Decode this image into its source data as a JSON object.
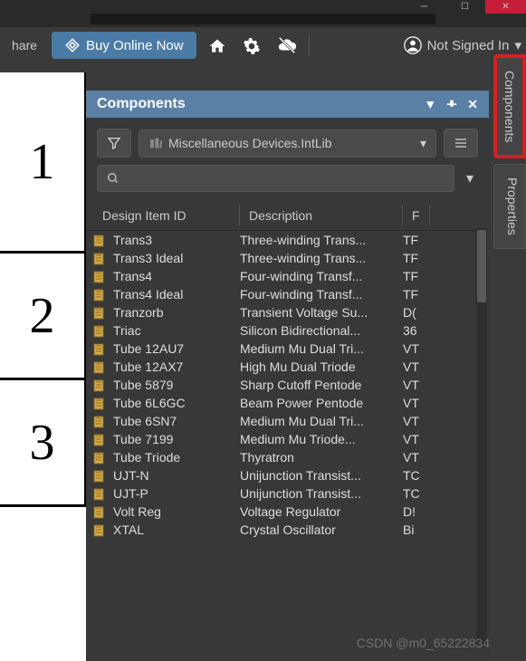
{
  "toolbar": {
    "share_label": "hare",
    "buy_label": "Buy Online Now",
    "signin_label": "Not Signed In"
  },
  "schematic": {
    "cells": [
      "1",
      "2",
      "3"
    ]
  },
  "panel": {
    "title": "Components",
    "library": "Miscellaneous Devices.IntLib",
    "search_placeholder": ""
  },
  "columns": {
    "id": "Design Item ID",
    "desc": "Description",
    "f": "F"
  },
  "rows": [
    {
      "id": "Trans3",
      "desc": "Three-winding Trans...",
      "f": "TF"
    },
    {
      "id": "Trans3 Ideal",
      "desc": "Three-winding Trans...",
      "f": "TF"
    },
    {
      "id": "Trans4",
      "desc": "Four-winding Transf...",
      "f": "TF"
    },
    {
      "id": "Trans4 Ideal",
      "desc": "Four-winding Transf...",
      "f": "TF"
    },
    {
      "id": "Tranzorb",
      "desc": "Transient Voltage Su...",
      "f": "D("
    },
    {
      "id": "Triac",
      "desc": "Silicon Bidirectional...",
      "f": "36"
    },
    {
      "id": "Tube 12AU7",
      "desc": "Medium Mu Dual Tri...",
      "f": "VT"
    },
    {
      "id": "Tube 12AX7",
      "desc": "High Mu Dual Triode",
      "f": "VT"
    },
    {
      "id": "Tube 5879",
      "desc": "Sharp Cutoff Pentode",
      "f": "VT"
    },
    {
      "id": "Tube 6L6GC",
      "desc": "Beam Power Pentode",
      "f": "VT"
    },
    {
      "id": "Tube 6SN7",
      "desc": "Medium Mu Dual Tri...",
      "f": "VT"
    },
    {
      "id": "Tube 7199",
      "desc": "Medium Mu Triode...",
      "f": "VT"
    },
    {
      "id": "Tube Triode",
      "desc": "Thyratron",
      "f": "VT"
    },
    {
      "id": "UJT-N",
      "desc": "Unijunction Transist...",
      "f": "TC"
    },
    {
      "id": "UJT-P",
      "desc": "Unijunction Transist...",
      "f": "TC"
    },
    {
      "id": "Volt Reg",
      "desc": "Voltage Regulator",
      "f": "D!"
    },
    {
      "id": "XTAL",
      "desc": "Crystal Oscillator",
      "f": "Bi"
    }
  ],
  "side_tabs": {
    "components": "Components",
    "properties": "Properties"
  },
  "watermark": "CSDN @m0_65222834"
}
